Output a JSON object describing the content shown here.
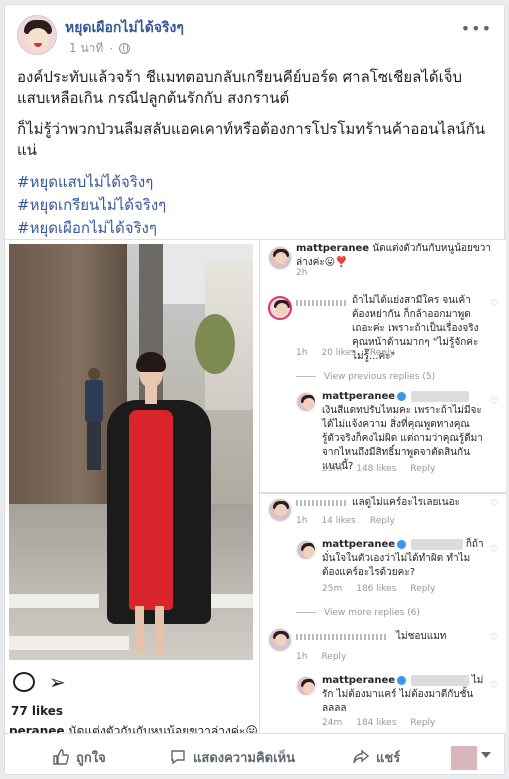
{
  "post": {
    "page_name": "หยุดเผือกไม่ได้จริงๆ",
    "timestamp": "1 นาที",
    "more_icon": "•••",
    "text_line1": "องค์ประทับแล้วจร้า ชีแมทตอบกลับเกรียนคีย์บอร์ด ศาลโซเชียลได้เจ็บแสบเหลือเกิน กรณีปลูกต้นรักกับ สงกรานต์",
    "text_line2": "ก็ไม่รู้ว่าพวกป่วนลืมสลับแอคเคาท์หรือต้องการโปรโมทร้านค้าออนไลน์กันแน่",
    "hashtags": [
      "#หยุดแสบไม่ได้จริงๆ",
      "#หยุดเกรียนไม่ได้จริงๆ",
      "#หยุดเผือกไม่ได้จริงๆ"
    ]
  },
  "instagram": {
    "likes": "77 likes",
    "caption_user": "peranee",
    "caption_text": " นัดแต่งตัวกันกับหนูน้อยขวาล่างค่ะ😛"
  },
  "comments_a": {
    "top": {
      "user": "mattperanee",
      "text": "นัดแต่งตัวกันกับหนูน้อยขวาล่างค่ะ😛❣️",
      "time": "2h"
    },
    "c1": {
      "text": "ถ้าไม่ได้แย่งสามีใคร จนเค้าต้องหย่ากัน ก็กล้าออกมาพูดเถอะค่ะ เพราะถ้าเป็นเรื่องจริงคุณหน้าด้านมากๆ \"ไม่รู้จักค่ะ ไม่รู้๊...ค่ะ\"",
      "time": "1h",
      "likes": "20 likes",
      "reply": "Reply"
    },
    "view_previous": "View previous replies (5)",
    "c2": {
      "user": "mattperanee",
      "text": "เงินสีแดทปรับไหมคะ เพราะถ้าไม่มีจะได้ไม่แจ้งความ สิ่งที่คุณพูดทางคุณรู้ตัวจริงก็คงไม่ผิด แต่ถามว่าคุณรู้ดีมาจากไหนถึงมีสิทธิ์มาพูดจาตัดสินกันแบบนี้?",
      "time": "59m",
      "likes": "148 likes",
      "reply": "Reply"
    }
  },
  "comments_b": {
    "c1": {
      "text": "แลดูไม่แคร์อะไรเลยเนอะ",
      "time": "1h",
      "likes": "14 likes",
      "reply": "Reply"
    },
    "c2": {
      "user": "mattperanee",
      "text": "ก็ถ้ามั่นใจในตัวเองว่าไม่ได้ทำผิด ทำไมต้องแคร์อะไรด้วยคะ?",
      "time": "25m",
      "likes": "186 likes",
      "reply": "Reply"
    },
    "view_more": "View more replies (6)",
    "c3": {
      "text": "ไม่ชอบแมท",
      "time": "1h",
      "reply": "Reply"
    },
    "c4": {
      "user": "mattperanee",
      "text": "ไม่รัก ไม่ต้องมาแคร์ ไม่ต้องมาตีกับชั้นลลลล",
      "time": "24m",
      "likes": "184 likes",
      "reply": "Reply"
    }
  },
  "actions": {
    "like": "ถูกใจ",
    "comment": "แสดงความคิดเห็น",
    "share": "แชร์"
  }
}
